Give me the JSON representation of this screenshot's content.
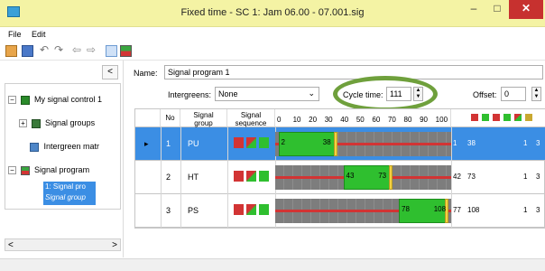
{
  "window": {
    "title": "Fixed time - SC 1: Jam 06.00 - 07.001.sig",
    "min": "–",
    "max": "□",
    "close": "✕"
  },
  "menu": {
    "file": "File",
    "edit": "Edit"
  },
  "toolbar": {
    "icons": [
      "new-icon",
      "save-icon",
      "undo-icon",
      "redo-icon",
      "back-icon",
      "forward-icon",
      "grid-view-icon",
      "signal-view-icon"
    ]
  },
  "left_panel": {
    "collapse": "<",
    "tree": [
      {
        "label": "My signal control 1",
        "icon": "signal-control-icon"
      },
      {
        "label": "Signal groups",
        "icon": "signal-groups-icon"
      },
      {
        "label": "Intergreen matr",
        "icon": "intergreen-icon"
      },
      {
        "label": "Signal program",
        "icon": "signal-program-icon"
      }
    ],
    "selected_item": {
      "line1": "1: Signal pro",
      "line2": "Signal group"
    },
    "scroll_left": "<",
    "scroll_right": ">"
  },
  "form": {
    "name_label": "Name:",
    "name_value": "Signal program 1",
    "intergreens_label": "Intergreens:",
    "intergreens_value": "None",
    "cycle_label": "Cycle time:",
    "cycle_value": "111",
    "offset_label": "Offset:",
    "offset_value": "0"
  },
  "grid": {
    "headers": {
      "no": "No",
      "group_line1": "Signal",
      "group_line2": "group",
      "sequence_line1": "Signal",
      "sequence_line2": "sequence"
    },
    "ticks": [
      "0",
      "10",
      "20",
      "30",
      "40",
      "50",
      "60",
      "70",
      "80",
      "90",
      "100"
    ],
    "rows": [
      {
        "no": "1",
        "group": "PU",
        "green_start": "2",
        "green_end": "38",
        "start_val": "1",
        "end_val": "38",
        "col_a": "1",
        "col_b": "3",
        "green_from": 2,
        "green_to": 38
      },
      {
        "no": "2",
        "group": "HT",
        "green_start": "43",
        "green_end": "73",
        "start_val": "42",
        "end_val": "73",
        "col_a": "1",
        "col_b": "3",
        "green_from": 43,
        "green_to": 73
      },
      {
        "no": "3",
        "group": "PS",
        "green_start": "78",
        "green_end": "108",
        "start_val": "77",
        "end_val": "108",
        "col_a": "1",
        "col_b": "3",
        "green_from": 78,
        "green_to": 108
      }
    ]
  },
  "colors": {
    "accent": "#3b8ee4",
    "highlight_ring": "#6fa03c",
    "green": "#2fbf2f",
    "red": "#d23434",
    "amber": "#f4d242"
  }
}
